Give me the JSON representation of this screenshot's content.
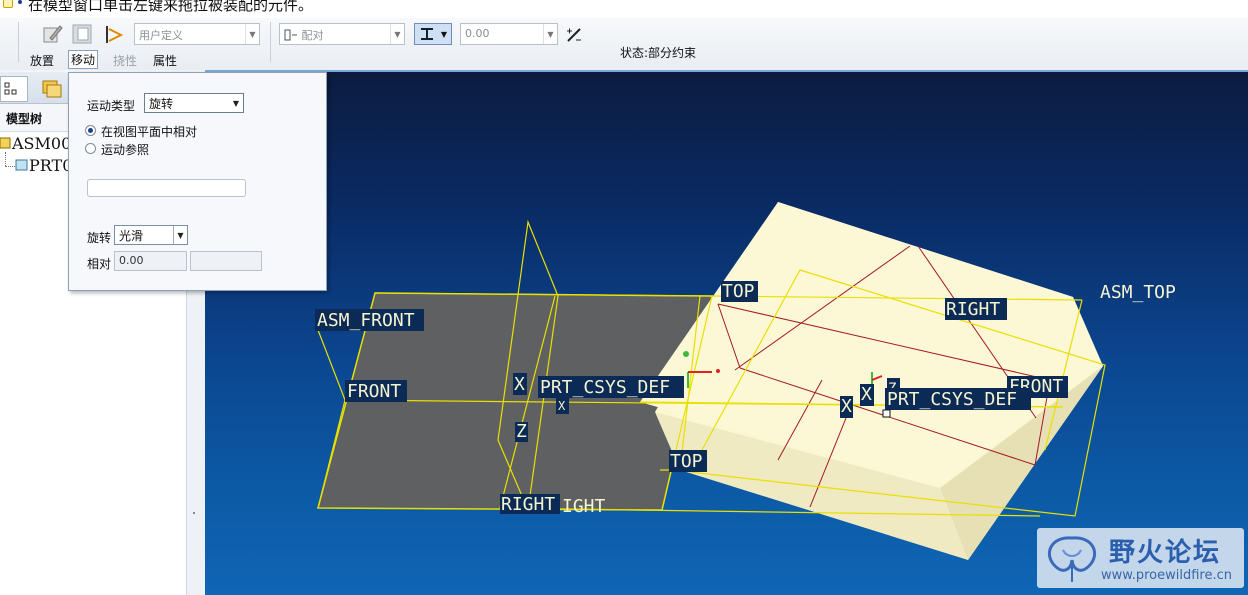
{
  "message": "在模型窗口单击左键来拖拉被装配的元件。",
  "toolbar": {
    "user_defined_placeholder": "用户定义",
    "constraint_type": "配对",
    "offset_value": "0.00",
    "status": "状态:部分约束",
    "tabs": [
      "放置",
      "移动",
      "挠性",
      "属性"
    ]
  },
  "left_panel": {
    "title": "模型树",
    "tree": [
      "ASM00",
      "PRT0"
    ]
  },
  "move_panel": {
    "motion_type_label": "运动类型",
    "motion_type_value": "旋转",
    "option_view_plane": "在视图平面中相对",
    "option_motion_ref": "运动参照",
    "rotate_label": "旋转",
    "rotate_mode": "光滑",
    "relative_label": "相对",
    "relative_value": "0.00"
  },
  "viewport_labels": {
    "asm_front": "ASM_FRONT",
    "front_left": "FRONT",
    "top_upper": "TOP",
    "right_upper": "RIGHT",
    "asm_top": "ASM_TOP",
    "x1": "X",
    "csys_left": "PRT_CSYS_DEF",
    "x_small1": "X",
    "z1": "Z",
    "front_right": "FRONT",
    "x2": "X",
    "x3": "X",
    "z2": "Z",
    "csys_right": "PRT_CSYS_DEF",
    "top_lower": "TOP",
    "right_lower": "RIGHT",
    "ight": "IGHT"
  },
  "watermark": {
    "name": "野火论坛",
    "url": "www.proewildfire.cn"
  },
  "colors": {
    "background_top": "#0c1c40",
    "background_bottom": "#0f66b5",
    "datum": "#e8e000",
    "part": "#fbf7d2",
    "gray_plane": "#5f6062"
  }
}
